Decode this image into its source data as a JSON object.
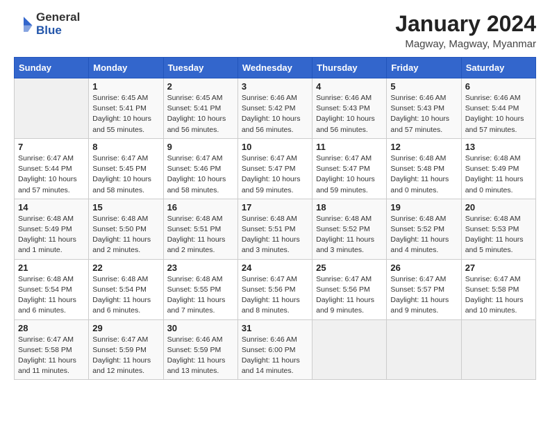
{
  "header": {
    "logo_general": "General",
    "logo_blue": "Blue",
    "title": "January 2024",
    "subtitle": "Magway, Magway, Myanmar"
  },
  "days_of_week": [
    "Sunday",
    "Monday",
    "Tuesday",
    "Wednesday",
    "Thursday",
    "Friday",
    "Saturday"
  ],
  "weeks": [
    [
      {
        "day": "",
        "info": ""
      },
      {
        "day": "1",
        "info": "Sunrise: 6:45 AM\nSunset: 5:41 PM\nDaylight: 10 hours\nand 55 minutes."
      },
      {
        "day": "2",
        "info": "Sunrise: 6:45 AM\nSunset: 5:41 PM\nDaylight: 10 hours\nand 56 minutes."
      },
      {
        "day": "3",
        "info": "Sunrise: 6:46 AM\nSunset: 5:42 PM\nDaylight: 10 hours\nand 56 minutes."
      },
      {
        "day": "4",
        "info": "Sunrise: 6:46 AM\nSunset: 5:43 PM\nDaylight: 10 hours\nand 56 minutes."
      },
      {
        "day": "5",
        "info": "Sunrise: 6:46 AM\nSunset: 5:43 PM\nDaylight: 10 hours\nand 57 minutes."
      },
      {
        "day": "6",
        "info": "Sunrise: 6:46 AM\nSunset: 5:44 PM\nDaylight: 10 hours\nand 57 minutes."
      }
    ],
    [
      {
        "day": "7",
        "info": "Sunrise: 6:47 AM\nSunset: 5:44 PM\nDaylight: 10 hours\nand 57 minutes."
      },
      {
        "day": "8",
        "info": "Sunrise: 6:47 AM\nSunset: 5:45 PM\nDaylight: 10 hours\nand 58 minutes."
      },
      {
        "day": "9",
        "info": "Sunrise: 6:47 AM\nSunset: 5:46 PM\nDaylight: 10 hours\nand 58 minutes."
      },
      {
        "day": "10",
        "info": "Sunrise: 6:47 AM\nSunset: 5:47 PM\nDaylight: 10 hours\nand 59 minutes."
      },
      {
        "day": "11",
        "info": "Sunrise: 6:47 AM\nSunset: 5:47 PM\nDaylight: 10 hours\nand 59 minutes."
      },
      {
        "day": "12",
        "info": "Sunrise: 6:48 AM\nSunset: 5:48 PM\nDaylight: 11 hours\nand 0 minutes."
      },
      {
        "day": "13",
        "info": "Sunrise: 6:48 AM\nSunset: 5:49 PM\nDaylight: 11 hours\nand 0 minutes."
      }
    ],
    [
      {
        "day": "14",
        "info": "Sunrise: 6:48 AM\nSunset: 5:49 PM\nDaylight: 11 hours\nand 1 minute."
      },
      {
        "day": "15",
        "info": "Sunrise: 6:48 AM\nSunset: 5:50 PM\nDaylight: 11 hours\nand 2 minutes."
      },
      {
        "day": "16",
        "info": "Sunrise: 6:48 AM\nSunset: 5:51 PM\nDaylight: 11 hours\nand 2 minutes."
      },
      {
        "day": "17",
        "info": "Sunrise: 6:48 AM\nSunset: 5:51 PM\nDaylight: 11 hours\nand 3 minutes."
      },
      {
        "day": "18",
        "info": "Sunrise: 6:48 AM\nSunset: 5:52 PM\nDaylight: 11 hours\nand 3 minutes."
      },
      {
        "day": "19",
        "info": "Sunrise: 6:48 AM\nSunset: 5:52 PM\nDaylight: 11 hours\nand 4 minutes."
      },
      {
        "day": "20",
        "info": "Sunrise: 6:48 AM\nSunset: 5:53 PM\nDaylight: 11 hours\nand 5 minutes."
      }
    ],
    [
      {
        "day": "21",
        "info": "Sunrise: 6:48 AM\nSunset: 5:54 PM\nDaylight: 11 hours\nand 6 minutes."
      },
      {
        "day": "22",
        "info": "Sunrise: 6:48 AM\nSunset: 5:54 PM\nDaylight: 11 hours\nand 6 minutes."
      },
      {
        "day": "23",
        "info": "Sunrise: 6:48 AM\nSunset: 5:55 PM\nDaylight: 11 hours\nand 7 minutes."
      },
      {
        "day": "24",
        "info": "Sunrise: 6:47 AM\nSunset: 5:56 PM\nDaylight: 11 hours\nand 8 minutes."
      },
      {
        "day": "25",
        "info": "Sunrise: 6:47 AM\nSunset: 5:56 PM\nDaylight: 11 hours\nand 9 minutes."
      },
      {
        "day": "26",
        "info": "Sunrise: 6:47 AM\nSunset: 5:57 PM\nDaylight: 11 hours\nand 9 minutes."
      },
      {
        "day": "27",
        "info": "Sunrise: 6:47 AM\nSunset: 5:58 PM\nDaylight: 11 hours\nand 10 minutes."
      }
    ],
    [
      {
        "day": "28",
        "info": "Sunrise: 6:47 AM\nSunset: 5:58 PM\nDaylight: 11 hours\nand 11 minutes."
      },
      {
        "day": "29",
        "info": "Sunrise: 6:47 AM\nSunset: 5:59 PM\nDaylight: 11 hours\nand 12 minutes."
      },
      {
        "day": "30",
        "info": "Sunrise: 6:46 AM\nSunset: 5:59 PM\nDaylight: 11 hours\nand 13 minutes."
      },
      {
        "day": "31",
        "info": "Sunrise: 6:46 AM\nSunset: 6:00 PM\nDaylight: 11 hours\nand 14 minutes."
      },
      {
        "day": "",
        "info": ""
      },
      {
        "day": "",
        "info": ""
      },
      {
        "day": "",
        "info": ""
      }
    ]
  ]
}
